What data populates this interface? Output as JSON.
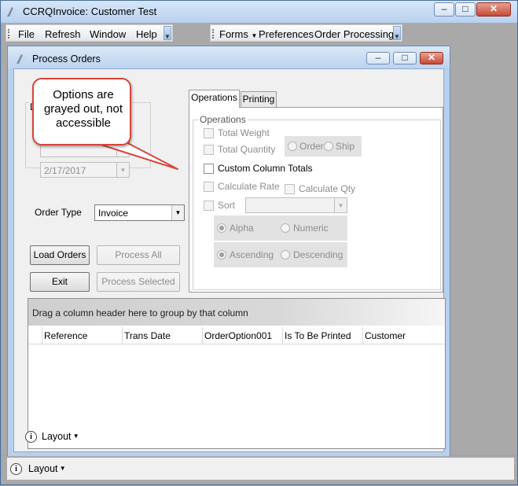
{
  "app": {
    "title": "CCRQInvoice: Customer Test",
    "minimize": "–",
    "maximize": "□",
    "close": "✕"
  },
  "menu": {
    "file": "File",
    "refresh": "Refresh",
    "window": "Window",
    "help": "Help",
    "forms": "Forms",
    "preferences": "Preferences",
    "order_processing": "Order Processing"
  },
  "child": {
    "title": "Process Orders",
    "minimize": "–",
    "maximize": "□",
    "close": "✕"
  },
  "left_panel": {
    "date_label_fragment": "D",
    "date_value": "2/17/2017",
    "order_type_label": "Order Type",
    "order_type_value": "Invoice",
    "load_orders": "Load Orders",
    "process_all": "Process All",
    "exit": "Exit",
    "process_selected": "Process Selected"
  },
  "tabs": [
    {
      "label": "Operations",
      "active": true
    },
    {
      "label": "Printing",
      "active": false
    }
  ],
  "operations": {
    "group_label": "Operations",
    "total_weight": "Total Weight",
    "total_quantity": "Total Quantity",
    "order": "Order",
    "ship": "Ship",
    "custom_column_totals": "Custom Column Totals",
    "calculate_rate": "Calculate Rate",
    "calculate_qty": "Calculate Qty",
    "sort": "Sort",
    "alpha": "Alpha",
    "numeric": "Numeric",
    "ascending": "Ascending",
    "descending": "Descending"
  },
  "grid": {
    "group_hint": "Drag a column header here to group by that column",
    "columns": [
      "Reference",
      "Trans Date",
      "OrderOption001",
      "Is To Be Printed",
      "Customer"
    ]
  },
  "footer": {
    "child_layout": "Layout",
    "app_layout": "Layout"
  },
  "callout": {
    "text": "Options are grayed out, not accessible",
    "color": "#d9453a"
  }
}
